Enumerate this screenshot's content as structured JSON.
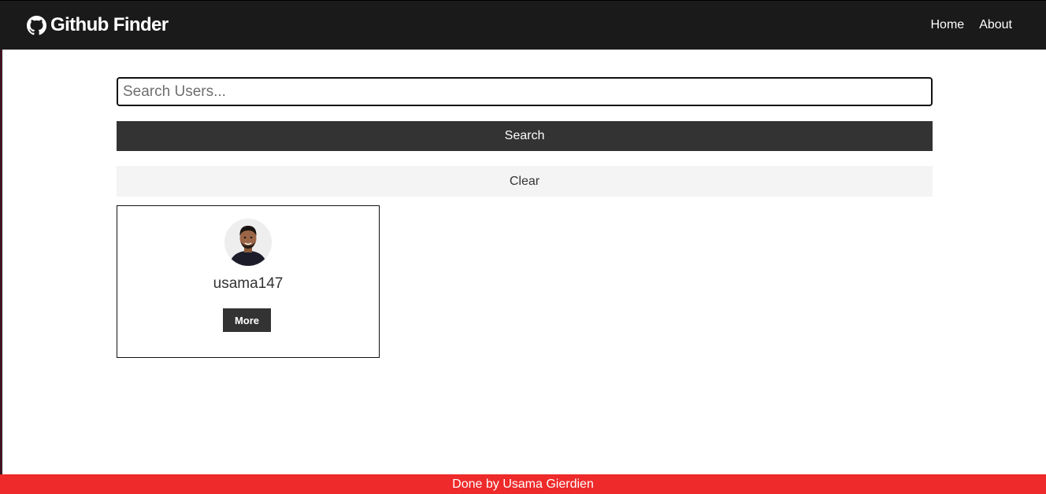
{
  "navbar": {
    "brand_icon": "github-icon",
    "title": "Github Finder",
    "links": [
      {
        "label": "Home"
      },
      {
        "label": "About"
      }
    ]
  },
  "search": {
    "placeholder": "Search Users...",
    "value": "",
    "submit_label": "Search",
    "clear_label": "Clear"
  },
  "users": [
    {
      "login": "usama147",
      "avatar": "user-avatar",
      "more_label": "More"
    }
  ],
  "footer": {
    "text": "Done by Usama Gierdien"
  },
  "colors": {
    "navbar_bg": "#1a1a1a",
    "dark_button": "#333333",
    "light_button": "#f4f4f4",
    "footer_bg": "#ee2a2a"
  }
}
